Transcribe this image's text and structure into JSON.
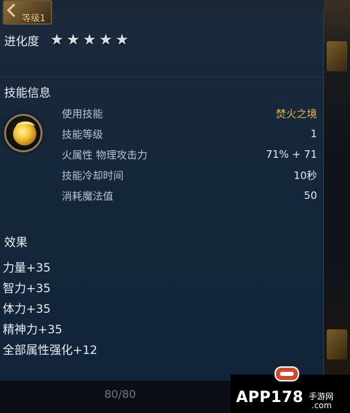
{
  "level_badge": {
    "label": "等级1"
  },
  "evolution": {
    "label": "进化度",
    "stars": [
      "★",
      "★",
      "★",
      "★",
      "★"
    ]
  },
  "skill_section": {
    "title": "技能信息",
    "rows": [
      {
        "label": "使用技能",
        "value": "焚火之境"
      },
      {
        "label": "技能等级",
        "value": "1"
      },
      {
        "label": "火属性 物理攻击力",
        "value": "71% + 71"
      },
      {
        "label": "技能冷却时间",
        "value": "10秒"
      },
      {
        "label": "消耗魔法值",
        "value": "50"
      }
    ]
  },
  "effect_section": {
    "title": "效果",
    "items": [
      "力量+35",
      "智力+35",
      "体力+35",
      "精神力+35",
      "全部属性强化+12"
    ]
  },
  "footer": {
    "page_counter": "80/80"
  },
  "watermark": {
    "text": "APP178",
    "sub": "手游网",
    "domain": ".com"
  },
  "colors": {
    "gold": "#e3b84a",
    "panel": "#16273a"
  }
}
